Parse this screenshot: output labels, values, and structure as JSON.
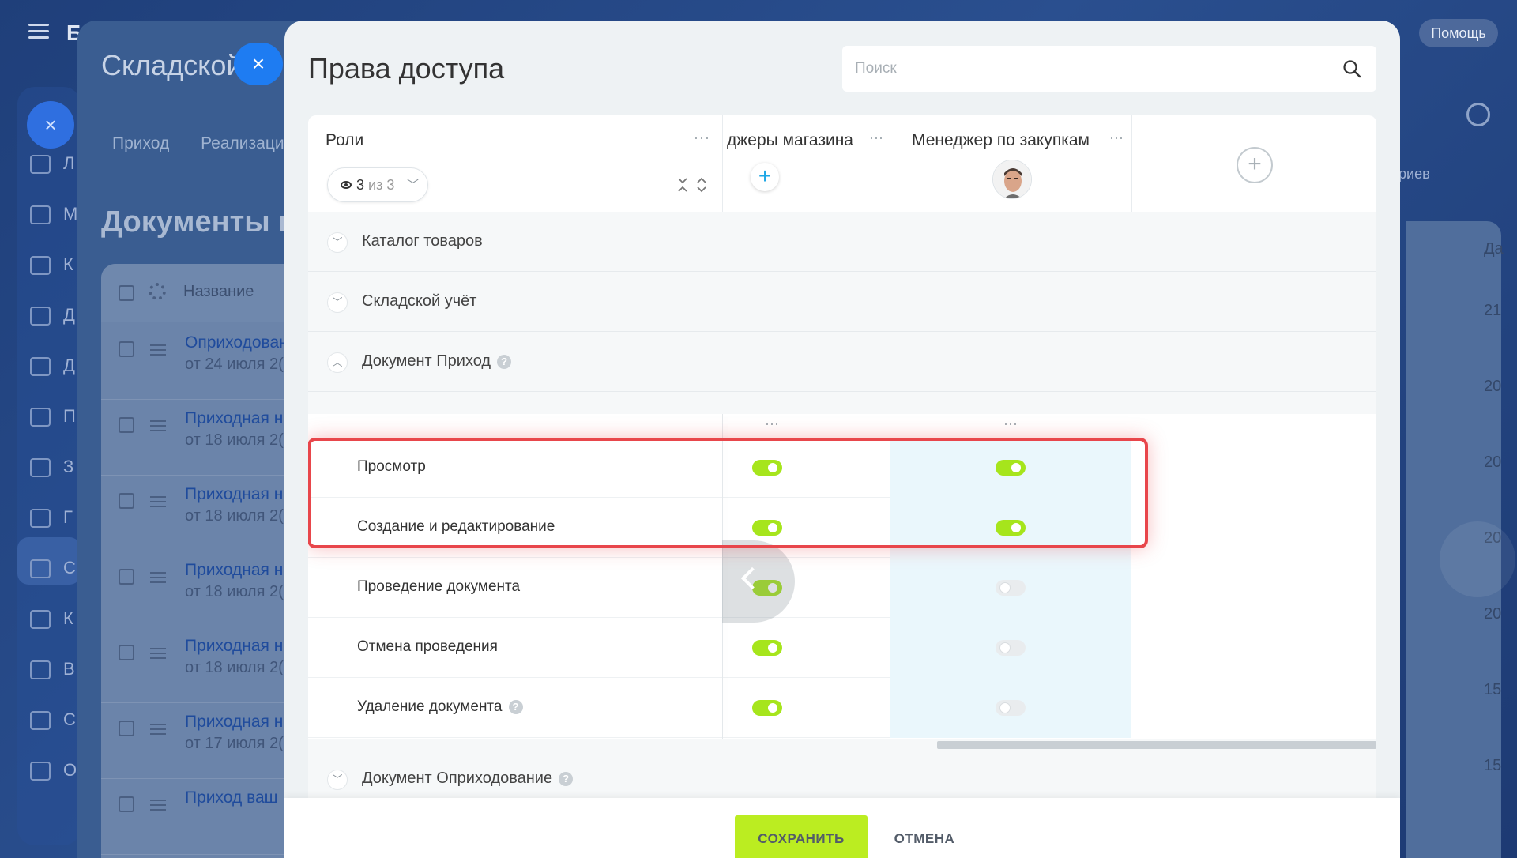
{
  "background": {
    "brand_letter": "Б",
    "help_label": "Помощь",
    "panel_title": "Складской",
    "tabs": [
      "Приход",
      "Реализаци"
    ],
    "docs_title": "Документы п",
    "table_header": "Название",
    "rail_letters": [
      "Л",
      "М",
      "К",
      "Д",
      "Д",
      "П",
      "З",
      "Г",
      "С",
      "К",
      "В",
      "С",
      "О"
    ],
    "rows": [
      {
        "title": "Оприходован",
        "date": "от 24 июля 2("
      },
      {
        "title": "Приходная н",
        "date": "от 18 июля 2("
      },
      {
        "title": "Приходная н",
        "date": "от 18 июля 2("
      },
      {
        "title": "Приходная н",
        "date": "от 18 июля 2("
      },
      {
        "title": "Приходная н",
        "date": "от 18 июля 2("
      },
      {
        "title": "Приходная н",
        "date": "от 17 июля 2("
      },
      {
        "title": "Приход ваш",
        "date": ""
      }
    ],
    "right_header": "Да",
    "right_top": "ариев",
    "right_numbers": [
      "21",
      "20",
      "20",
      "20",
      "20",
      "15",
      "15"
    ]
  },
  "modal": {
    "title": "Права доступа",
    "search_placeholder": "Поиск",
    "roles_label": "Роли",
    "menu_dots": "···",
    "roles_count": {
      "shown": "3",
      "of": "из 3"
    },
    "roles": [
      {
        "name": "джеры магазина"
      },
      {
        "name": "Менеджер по закупкам"
      }
    ],
    "sections": [
      {
        "label": "Каталог товаров",
        "expanded": false,
        "help": false
      },
      {
        "label": "Складской учёт",
        "expanded": false,
        "help": false
      },
      {
        "label": "Документ Приход",
        "expanded": true,
        "help": true
      },
      {
        "label": "Документ Оприходование",
        "expanded": false,
        "help": true
      }
    ],
    "help_glyph": "?",
    "permissions": [
      {
        "label": "Просмотр",
        "help": false,
        "role1": true,
        "role2": true
      },
      {
        "label": "Создание и редактирование",
        "help": false,
        "role1": true,
        "role2": true
      },
      {
        "label": "Проведение документа",
        "help": false,
        "role1": true,
        "role2": false
      },
      {
        "label": "Отмена проведения",
        "help": false,
        "role1": true,
        "role2": false
      },
      {
        "label": "Удаление документа",
        "help": true,
        "role1": true,
        "role2": false
      }
    ],
    "highlight_color": "#e8464b",
    "toggle_on_color": "#a6e51c",
    "save_label": "СОХРАНИТЬ",
    "cancel_label": "ОТМЕНА"
  }
}
